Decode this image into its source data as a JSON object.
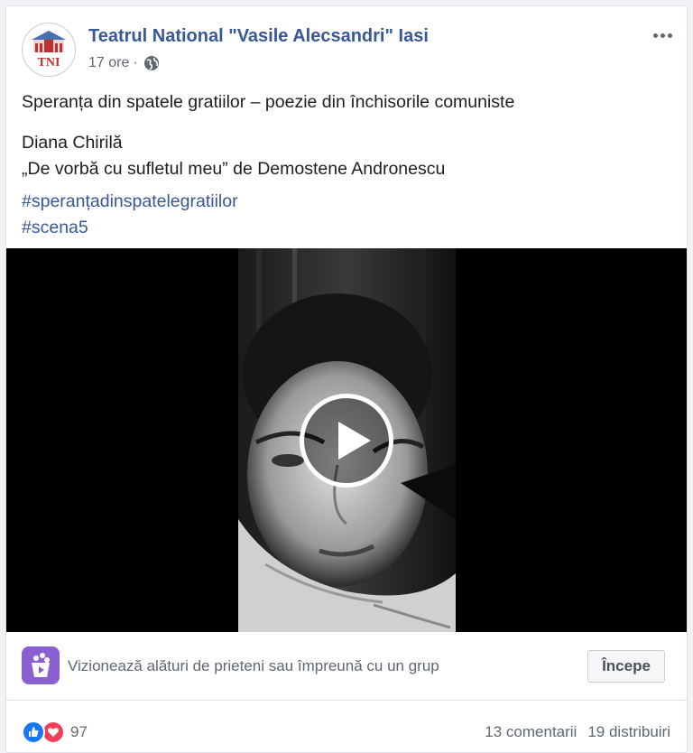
{
  "post": {
    "page_name": "Teatrul National \"Vasile Alecsandri\" Iasi",
    "time": "17 ore",
    "separator": "·",
    "privacy_icon": "globe-icon",
    "avatar_text": "TNI",
    "lines": {
      "title": "Speranța din spatele gratiilor – poezie din închisorile comuniste",
      "author": "Diana Chirilă",
      "poem": "„De vorbă cu sufletul meu” de Demostene Andronescu",
      "hashtag1": "#speranțadinspatelegratiilor",
      "hashtag2": "#scena5"
    }
  },
  "watch_party": {
    "text": "Vizionează alături de prieteni sau împreună cu un grup",
    "button": "Începe",
    "icon": "watch-party-icon"
  },
  "footer": {
    "reaction_count": "97",
    "comments": "13 comentarii",
    "shares": "19 distribuiri"
  },
  "colors": {
    "link": "#385898",
    "like": "#1877f2",
    "love": "#f33e58",
    "watch_icon": "#8a5fd2"
  }
}
